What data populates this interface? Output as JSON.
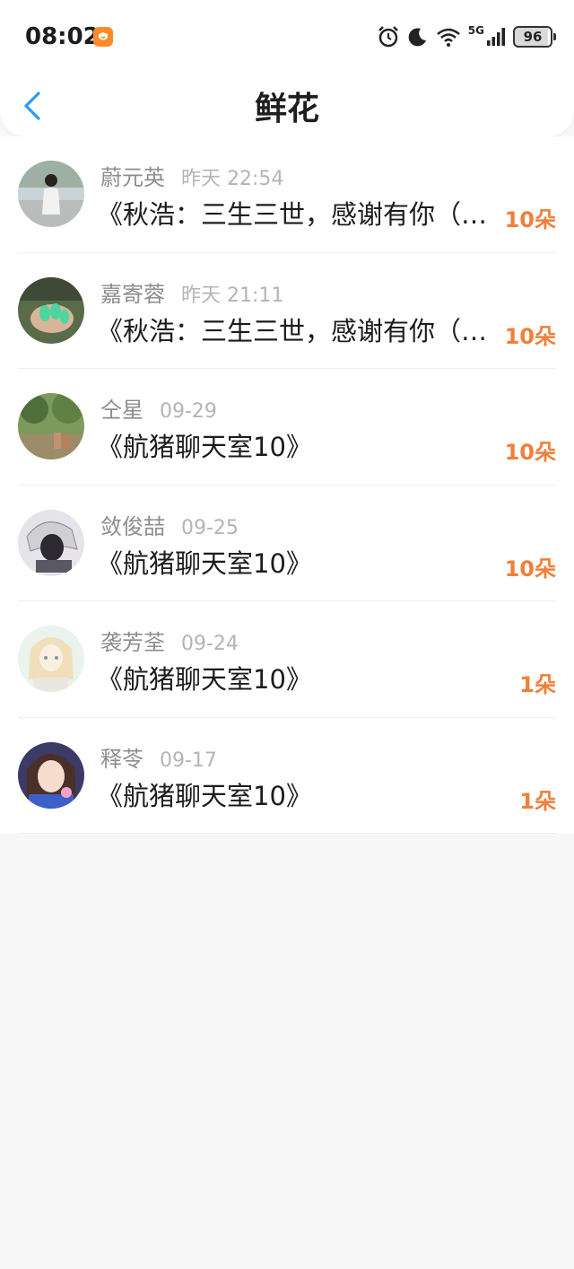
{
  "status_bar": {
    "time": "08:02",
    "network": "5G",
    "battery": "96",
    "icons": [
      "app-badge-icon",
      "alarm-icon",
      "moon-icon",
      "wifi-icon",
      "signal-icon",
      "battery-icon"
    ]
  },
  "header": {
    "title": "鲜花",
    "back_icon": "chevron-left-icon",
    "accent_color": "#2d9bf0"
  },
  "colors": {
    "count": "#f07f3a",
    "name": "#8d8d8d",
    "date": "#b4b4b4",
    "title": "#1c1c1c"
  },
  "list": [
    {
      "name": "蔚元英",
      "date": "昨天 22:54",
      "topic": "《秋浩：三生三世，感谢有你（五）》",
      "count": "10朵"
    },
    {
      "name": "嘉寄蓉",
      "date": "昨天 21:11",
      "topic": "《秋浩：三生三世，感谢有你（四）》",
      "count": "10朵"
    },
    {
      "name": "仝星",
      "date": "09-29",
      "topic": "《航猪聊天室10》",
      "count": "10朵"
    },
    {
      "name": "敛俊喆",
      "date": "09-25",
      "topic": "《航猪聊天室10》",
      "count": "10朵"
    },
    {
      "name": "袭芳荃",
      "date": "09-24",
      "topic": "《航猪聊天室10》",
      "count": "1朵"
    },
    {
      "name": "释苓",
      "date": "09-17",
      "topic": "《航猪聊天室10》",
      "count": "1朵"
    }
  ]
}
